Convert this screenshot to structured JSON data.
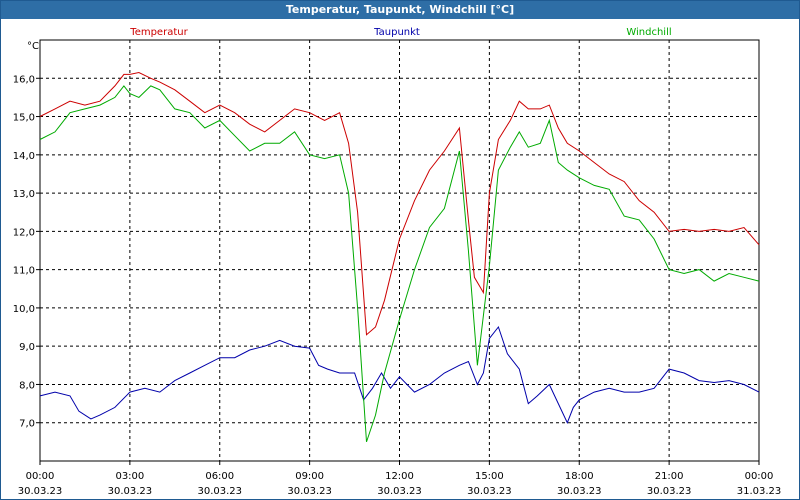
{
  "window": {
    "title": "Temperatur, Taupunkt, Windchill [°C]"
  },
  "chart_data": {
    "type": "line",
    "title": "Temperatur, Taupunkt, Windchill [°C]",
    "ylabel": "°C",
    "ylim": [
      6.0,
      17.0
    ],
    "yticks": [
      7.0,
      8.0,
      9.0,
      10.0,
      11.0,
      12.0,
      13.0,
      14.0,
      15.0,
      16.0
    ],
    "ytick_labels": [
      "7,0",
      "8,0",
      "9,0",
      "10,0",
      "11,0",
      "12,0",
      "13,0",
      "14,0",
      "15,0",
      "16,0"
    ],
    "xlim": [
      0,
      24
    ],
    "xtick_hours": [
      0,
      3,
      6,
      9,
      12,
      15,
      18,
      21,
      24
    ],
    "xtick_time_labels": [
      "00:00",
      "03:00",
      "06:00",
      "09:00",
      "12:00",
      "15:00",
      "18:00",
      "21:00",
      "00:00"
    ],
    "xtick_date_labels": [
      "30.03.23",
      "30.03.23",
      "30.03.23",
      "30.03.23",
      "30.03.23",
      "30.03.23",
      "30.03.23",
      "30.03.23",
      "31.03.23"
    ],
    "grid": true,
    "series": [
      {
        "name": "Temperatur",
        "color": "#cc0000",
        "x": [
          0.0,
          0.5,
          1.0,
          1.5,
          2.0,
          2.5,
          2.8,
          3.0,
          3.3,
          3.7,
          4.0,
          4.5,
          5.0,
          5.5,
          6.0,
          6.5,
          7.0,
          7.5,
          8.0,
          8.5,
          9.0,
          9.5,
          10.0,
          10.3,
          10.6,
          10.9,
          11.2,
          11.5,
          12.0,
          12.5,
          13.0,
          13.5,
          14.0,
          14.3,
          14.5,
          14.8,
          15.0,
          15.3,
          15.7,
          16.0,
          16.3,
          16.7,
          17.0,
          17.3,
          17.6,
          18.0,
          18.5,
          19.0,
          19.5,
          20.0,
          20.5,
          21.0,
          21.5,
          22.0,
          22.5,
          23.0,
          23.5,
          24.0
        ],
        "values": [
          15.0,
          15.2,
          15.4,
          15.3,
          15.4,
          15.8,
          16.1,
          16.1,
          16.15,
          16.0,
          15.9,
          15.7,
          15.4,
          15.1,
          15.3,
          15.1,
          14.8,
          14.6,
          14.9,
          15.2,
          15.1,
          14.9,
          15.1,
          14.3,
          12.5,
          9.3,
          9.5,
          10.2,
          11.8,
          12.8,
          13.6,
          14.1,
          14.7,
          12.3,
          10.8,
          10.4,
          13.0,
          14.4,
          14.9,
          15.4,
          15.2,
          15.2,
          15.3,
          14.7,
          14.3,
          14.1,
          13.8,
          13.5,
          13.3,
          12.8,
          12.5,
          12.0,
          12.05,
          12.0,
          12.05,
          12.0,
          12.1,
          11.65
        ]
      },
      {
        "name": "Taupunkt",
        "color": "#0000aa",
        "x": [
          0.0,
          0.5,
          1.0,
          1.3,
          1.7,
          2.0,
          2.5,
          3.0,
          3.5,
          4.0,
          4.5,
          5.0,
          5.5,
          6.0,
          6.5,
          7.0,
          7.5,
          8.0,
          8.5,
          9.0,
          9.3,
          9.6,
          10.0,
          10.5,
          10.8,
          11.1,
          11.4,
          11.7,
          12.0,
          12.5,
          13.0,
          13.5,
          14.0,
          14.3,
          14.6,
          14.8,
          15.0,
          15.3,
          15.6,
          16.0,
          16.3,
          16.6,
          17.0,
          17.3,
          17.6,
          17.8,
          18.0,
          18.5,
          19.0,
          19.5,
          20.0,
          20.5,
          21.0,
          21.5,
          22.0,
          22.5,
          23.0,
          23.5,
          24.0
        ],
        "values": [
          7.7,
          7.8,
          7.7,
          7.3,
          7.1,
          7.2,
          7.4,
          7.8,
          7.9,
          7.8,
          8.1,
          8.3,
          8.5,
          8.7,
          8.7,
          8.9,
          9.0,
          9.15,
          9.0,
          8.95,
          8.5,
          8.4,
          8.3,
          8.3,
          7.6,
          7.9,
          8.3,
          7.9,
          8.2,
          7.8,
          8.0,
          8.3,
          8.5,
          8.6,
          8.0,
          8.3,
          9.2,
          9.5,
          8.8,
          8.4,
          7.5,
          7.7,
          8.0,
          7.5,
          7.0,
          7.4,
          7.6,
          7.8,
          7.9,
          7.8,
          7.8,
          7.9,
          8.4,
          8.3,
          8.1,
          8.05,
          8.1,
          8.0,
          7.8
        ]
      },
      {
        "name": "Windchill",
        "color": "#00aa00",
        "x": [
          0.0,
          0.5,
          1.0,
          1.5,
          2.0,
          2.5,
          2.8,
          3.0,
          3.3,
          3.7,
          4.0,
          4.5,
          5.0,
          5.5,
          6.0,
          6.5,
          7.0,
          7.5,
          8.0,
          8.5,
          9.0,
          9.5,
          10.0,
          10.3,
          10.6,
          10.9,
          11.2,
          11.5,
          12.0,
          12.5,
          13.0,
          13.5,
          14.0,
          14.3,
          14.6,
          15.0,
          15.3,
          15.7,
          16.0,
          16.3,
          16.7,
          17.0,
          17.3,
          17.6,
          18.0,
          18.5,
          19.0,
          19.5,
          20.0,
          20.5,
          21.0,
          21.5,
          22.0,
          22.5,
          23.0,
          23.5,
          24.0
        ],
        "values": [
          14.4,
          14.6,
          15.1,
          15.2,
          15.3,
          15.5,
          15.8,
          15.6,
          15.5,
          15.8,
          15.7,
          15.2,
          15.1,
          14.7,
          14.9,
          14.5,
          14.1,
          14.3,
          14.3,
          14.6,
          14.0,
          13.9,
          14.0,
          13.0,
          10.0,
          6.5,
          7.2,
          8.3,
          9.7,
          11.0,
          12.1,
          12.6,
          14.1,
          11.5,
          8.5,
          11.1,
          13.6,
          14.2,
          14.6,
          14.2,
          14.3,
          14.9,
          13.8,
          13.6,
          13.4,
          13.2,
          13.1,
          12.4,
          12.3,
          11.8,
          11.0,
          10.9,
          11.0,
          10.7,
          10.9,
          10.8,
          10.7
        ]
      }
    ]
  }
}
